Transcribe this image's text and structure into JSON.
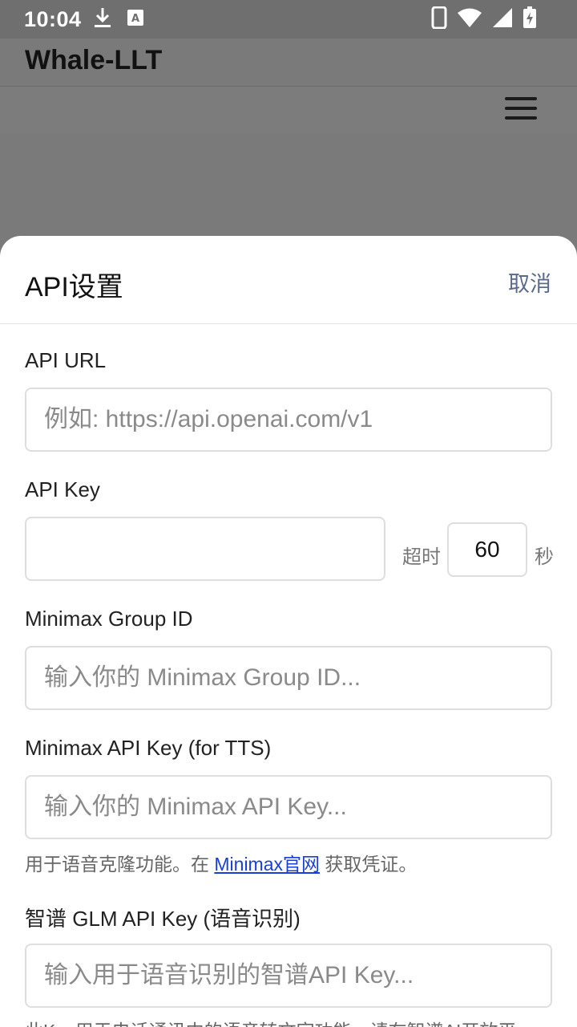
{
  "status_bar": {
    "time": "10:04",
    "left_icons": [
      "download-icon",
      "a-box-icon"
    ],
    "right_icons": [
      "phone-icon",
      "wifi-icon",
      "signal-icon",
      "battery-icon"
    ]
  },
  "app": {
    "title": "Whale-LLT"
  },
  "sheet": {
    "title": "API设置",
    "cancel_label": "取消",
    "api_url": {
      "label": "API URL",
      "placeholder": "例如: https://api.openai.com/v1",
      "value": ""
    },
    "api_key": {
      "label": "API Key",
      "value": "",
      "timeout_label": "超时",
      "timeout_value": "60",
      "timeout_unit": "秒"
    },
    "minimax_group": {
      "label": "Minimax Group ID",
      "placeholder": "输入你的 Minimax Group ID...",
      "value": ""
    },
    "minimax_key": {
      "label": "Minimax API Key (for TTS)",
      "placeholder": "输入你的 Minimax API Key...",
      "value": "",
      "help_prefix": "用于语音克隆功能。在 ",
      "help_link": "Minimax官网",
      "help_suffix": " 获取凭证。"
    },
    "glm_key": {
      "label": "智谱 GLM API Key (语音识别)",
      "placeholder": "输入用于语音识别的智谱API Key...",
      "value": "",
      "help": "此Key用于电话通讯中的语音转文字功能，请在智谱AI开放平"
    }
  },
  "colors": {
    "accent": "#5a6a8c",
    "link": "#1a3fd8",
    "backdrop": "#7a7a7a"
  }
}
